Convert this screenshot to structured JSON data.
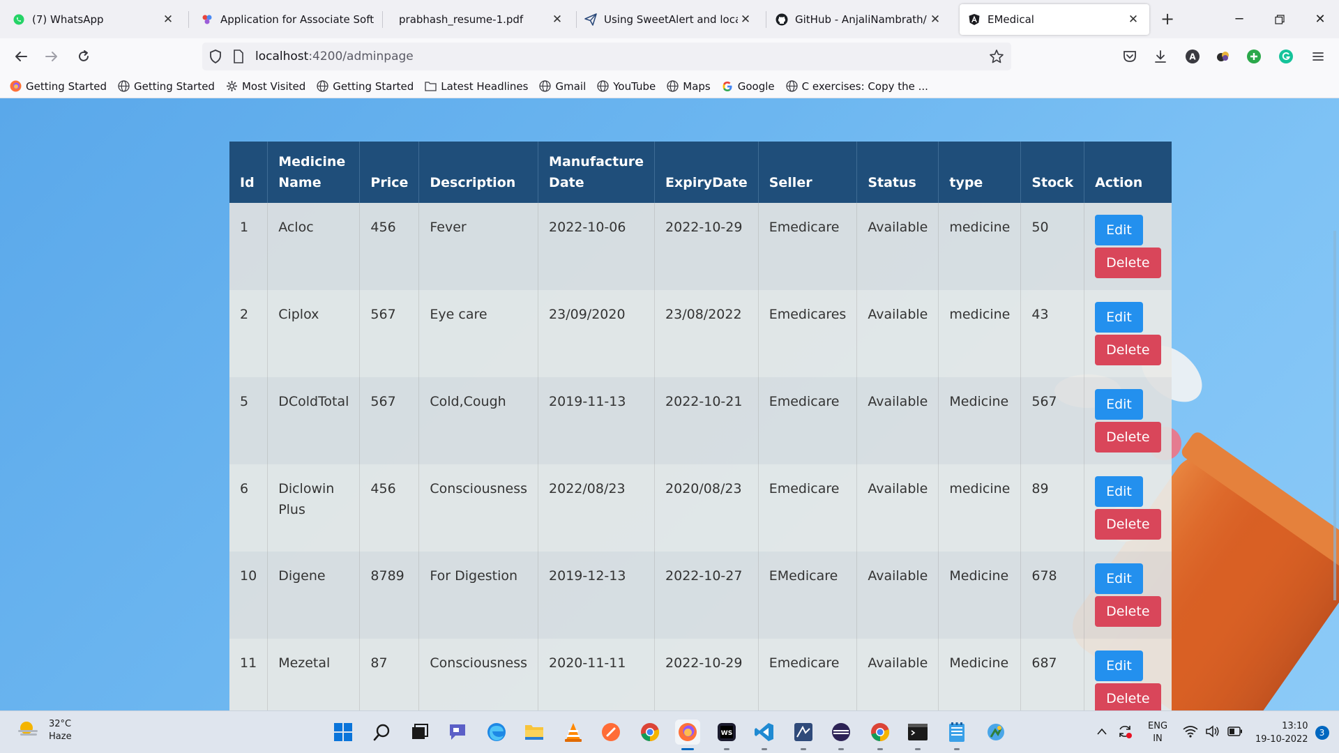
{
  "browser": {
    "tabs": [
      {
        "title": "(7) WhatsApp",
        "icon": "whatsapp-icon"
      },
      {
        "title": "Application for Associate Softw",
        "icon": "sheets-icon"
      },
      {
        "title": "prabhash_resume-1.pdf",
        "icon": "pdf-icon"
      },
      {
        "title": "Using SweetAlert and location.",
        "icon": "paper-plane-icon"
      },
      {
        "title": "GitHub - AnjaliNambrath/E-Me",
        "icon": "github-icon"
      },
      {
        "title": "EMedical",
        "icon": "angular-icon",
        "active": true
      }
    ],
    "url_host": "localhost",
    "url_path": ":4200/adminpage",
    "bookmarks": [
      {
        "label": "Getting Started",
        "icon": "firefox-icon"
      },
      {
        "label": "Getting Started",
        "icon": "globe-icon"
      },
      {
        "label": "Most Visited",
        "icon": "gear-icon"
      },
      {
        "label": "Getting Started",
        "icon": "globe-icon"
      },
      {
        "label": "Latest Headlines",
        "icon": "folder-icon"
      },
      {
        "label": "Gmail",
        "icon": "globe-icon"
      },
      {
        "label": "YouTube",
        "icon": "globe-icon"
      },
      {
        "label": "Maps",
        "icon": "globe-icon"
      },
      {
        "label": "Google",
        "icon": "google-icon"
      },
      {
        "label": "C exercises: Copy the ...",
        "icon": "globe-icon"
      }
    ]
  },
  "table": {
    "headers": {
      "id": "Id",
      "name_line1": "Medicine",
      "name_line2": "Name",
      "price": "Price",
      "description": "Description",
      "mfg_line1": "Manufacture",
      "mfg_line2": "Date",
      "expiry": "ExpiryDate",
      "seller": "Seller",
      "status": "Status",
      "type": "type",
      "stock": "Stock",
      "action": "Action"
    },
    "edit_label": "Edit",
    "delete_label": "Delete",
    "rows": [
      {
        "id": "1",
        "name": "Acloc",
        "price": "456",
        "description": "Fever",
        "mfg": "2022-10-06",
        "expiry": "2022-10-29",
        "seller": "Emedicare",
        "status": "Available",
        "type": "medicine",
        "stock": "50"
      },
      {
        "id": "2",
        "name": "Ciplox",
        "price": "567",
        "description": "Eye care",
        "mfg": "23/09/2020",
        "expiry": "23/08/2022",
        "seller": "Emedicares",
        "status": "Available",
        "type": "medicine",
        "stock": "43"
      },
      {
        "id": "5",
        "name": "DColdTotal",
        "price": "567",
        "description": "Cold,Cough",
        "mfg": "2019-11-13",
        "expiry": "2022-10-21",
        "seller": "Emedicare",
        "status": "Available",
        "type": "Medicine",
        "stock": "567"
      },
      {
        "id": "6",
        "name": "Diclowin Plus",
        "price": "456",
        "description": "Consciousness",
        "mfg": "2022/08/23",
        "expiry": "2020/08/23",
        "seller": "Emedicare",
        "status": "Available",
        "type": "medicine",
        "stock": "89"
      },
      {
        "id": "10",
        "name": "Digene",
        "price": "8789",
        "description": "For Digestion",
        "mfg": "2019-12-13",
        "expiry": "2022-10-27",
        "seller": "EMedicare",
        "status": "Available",
        "type": "Medicine",
        "stock": "678"
      },
      {
        "id": "11",
        "name": "Mezetal",
        "price": "87",
        "description": "Consciousness",
        "mfg": "2020-11-11",
        "expiry": "2022-10-29",
        "seller": "Emedicare",
        "status": "Available",
        "type": "Medicine",
        "stock": "687"
      }
    ]
  },
  "taskbar": {
    "weather_temp": "32°C",
    "weather_desc": "Haze",
    "apps": [
      "windows-start-icon",
      "search-icon",
      "task-view-icon",
      "chat-icon",
      "edge-icon",
      "file-explorer-icon",
      "vlc-icon",
      "postman-icon",
      "chrome-icon",
      "firefox-icon",
      "webstorm-icon",
      "vscode-icon",
      "eclipse-icon",
      "eclipse-ide-icon",
      "chrome-icon",
      "terminal-icon",
      "notepad-icon",
      "settings-icon"
    ],
    "lang_line1": "ENG",
    "lang_line2": "IN",
    "time": "13:10",
    "date": "19-10-2022",
    "notification_count": "3"
  },
  "colors": {
    "header_bg": "#1f4e7a",
    "edit_button": "#2390ee",
    "delete_button": "#d9465a",
    "page_bg": "#6cb6f0"
  }
}
